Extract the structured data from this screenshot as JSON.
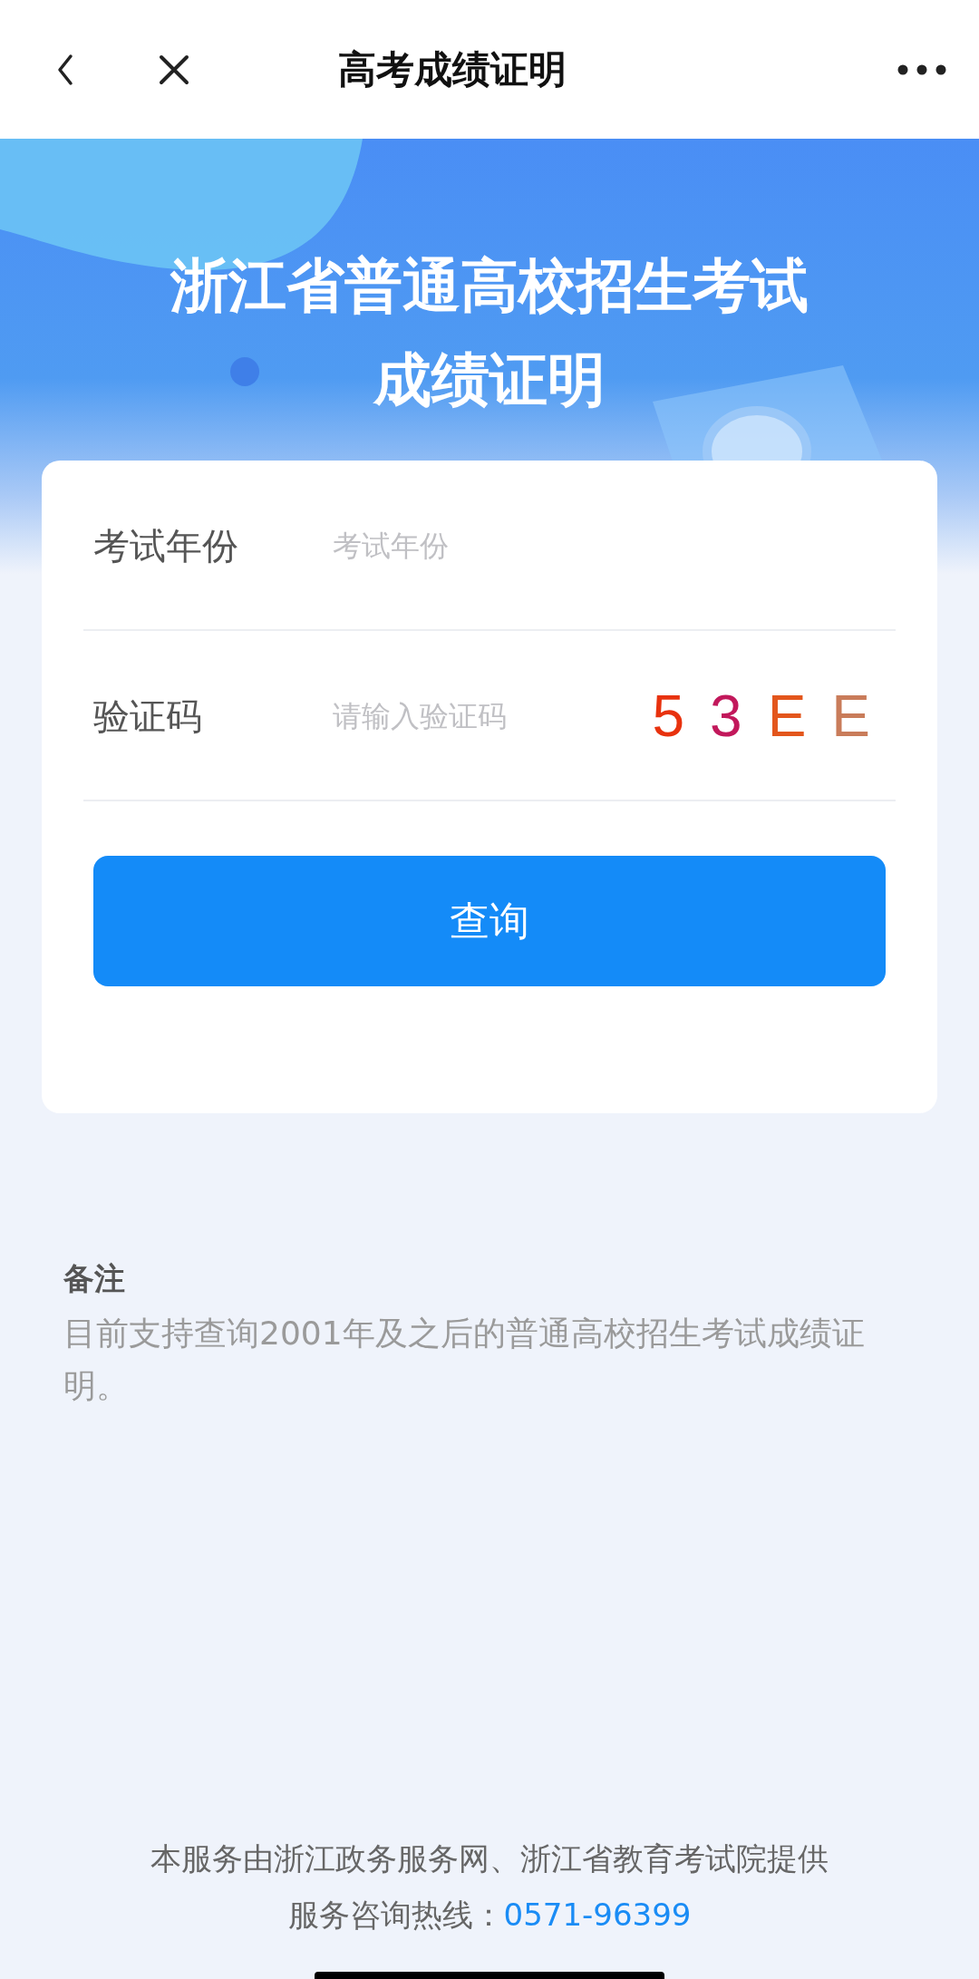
{
  "nav_bar": {
    "title": "高考成绩证明"
  },
  "banner": {
    "title_lines": [
      "浙江省普通高校招生考试",
      "成绩证明"
    ]
  },
  "form": {
    "fields": [
      {
        "kind": "text",
        "label": "考试年份",
        "placeholder": "考试年份"
      },
      {
        "kind": "captcha",
        "label": "验证码",
        "placeholder": "请输入验证码",
        "captcha": "53EE"
      }
    ],
    "submit_button": "查询"
  },
  "notes": {
    "heading": "备注",
    "text": "目前支持查询2001年及之后的普通高校招生考试成绩证明。"
  },
  "footer": {
    "provider": "本服务由浙江政务服务网、浙江省教育考试院提供",
    "hotline_label": "服务咨询热线：",
    "hotline_number": "0571-96399"
  }
}
